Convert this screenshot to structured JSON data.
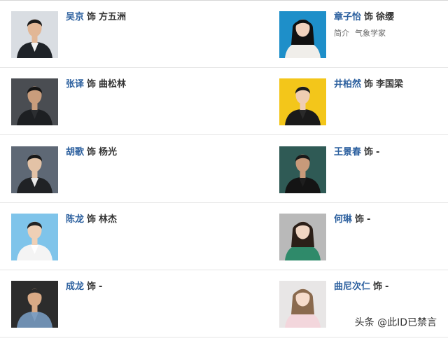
{
  "cast": {
    "rows": [
      {
        "left": {
          "actor": "吴京",
          "as_word": "饰",
          "role": "方五洲",
          "photo_icon": "actor-photo-icon",
          "photo_colors": {
            "bg": "#d9dde2",
            "suit": "#1f2328",
            "skin": "#e2b796",
            "hair": "#1a1a1a",
            "shirt": "#f2f2f2"
          }
        },
        "right": {
          "actor": "章子怡",
          "as_word": "饰",
          "role": "徐缨",
          "extra": [
            "简介",
            "气象学家"
          ],
          "photo_icon": "actor-photo-icon",
          "photo_colors": {
            "bg": "#1e8fc9",
            "suit": "#f0eeea",
            "skin": "#f1d2bd",
            "hair": "#101010",
            "shirt": "#f0eeea"
          }
        }
      },
      {
        "left": {
          "actor": "张译",
          "as_word": "饰",
          "role": "曲松林",
          "photo_icon": "actor-photo-icon",
          "photo_colors": {
            "bg": "#4a4d52",
            "suit": "#1d1f22",
            "skin": "#c99d7c",
            "hair": "#151515",
            "shirt": "#2c2e31"
          }
        },
        "right": {
          "actor": "井柏然",
          "as_word": "饰",
          "role": "李国梁",
          "photo_icon": "actor-photo-icon",
          "photo_colors": {
            "bg": "#f3c61a",
            "suit": "#1a1a1a",
            "skin": "#efcdb2",
            "hair": "#1c1c1c",
            "shirt": "#2a2a2a"
          }
        }
      },
      {
        "left": {
          "actor": "胡歌",
          "as_word": "饰",
          "role": "杨光",
          "photo_icon": "actor-photo-icon",
          "photo_colors": {
            "bg": "#5e6875",
            "suit": "#202225",
            "skin": "#e3c2a6",
            "hair": "#181818",
            "shirt": "#e9e9e9"
          }
        },
        "right": {
          "actor": "王景春",
          "as_word": "饰",
          "role": "-",
          "photo_icon": "actor-photo-icon",
          "photo_colors": {
            "bg": "#2f5a55",
            "suit": "#141414",
            "skin": "#c89a7a",
            "hair": "#1a1a1a",
            "shirt": "#1e1e1e"
          }
        }
      },
      {
        "left": {
          "actor": "陈龙",
          "as_word": "饰",
          "role": "林杰",
          "photo_icon": "actor-photo-icon",
          "photo_colors": {
            "bg": "#7fc4ea",
            "suit": "#f4f4f4",
            "skin": "#efd0b6",
            "hair": "#232323",
            "shirt": "#ffffff"
          }
        },
        "right": {
          "actor": "何琳",
          "as_word": "饰",
          "role": "-",
          "photo_icon": "actor-photo-icon",
          "photo_colors": {
            "bg": "#b9b9b9",
            "suit": "#2f8a6a",
            "skin": "#f1d6c3",
            "hair": "#2b1f18",
            "shirt": "#2f8a6a"
          }
        }
      },
      {
        "left": {
          "actor": "成龙",
          "as_word": "饰",
          "role": "-",
          "photo_icon": "actor-photo-icon",
          "photo_colors": {
            "bg": "#2c2c2c",
            "suit": "#6f8fb1",
            "skin": "#d9aa86",
            "hair": "#2a2a2a",
            "shirt": "#7f9ec0"
          }
        },
        "right": {
          "actor": "曲尼次仁",
          "as_word": "饰",
          "role": "-",
          "photo_icon": "actor-photo-icon",
          "photo_colors": {
            "bg": "#e8e6e6",
            "suit": "#f3d6dc",
            "skin": "#f6dccc",
            "hair": "#8a6a4e",
            "shirt": "#f3d6dc"
          }
        }
      }
    ]
  },
  "watermark": "头条 @此ID已禁言"
}
